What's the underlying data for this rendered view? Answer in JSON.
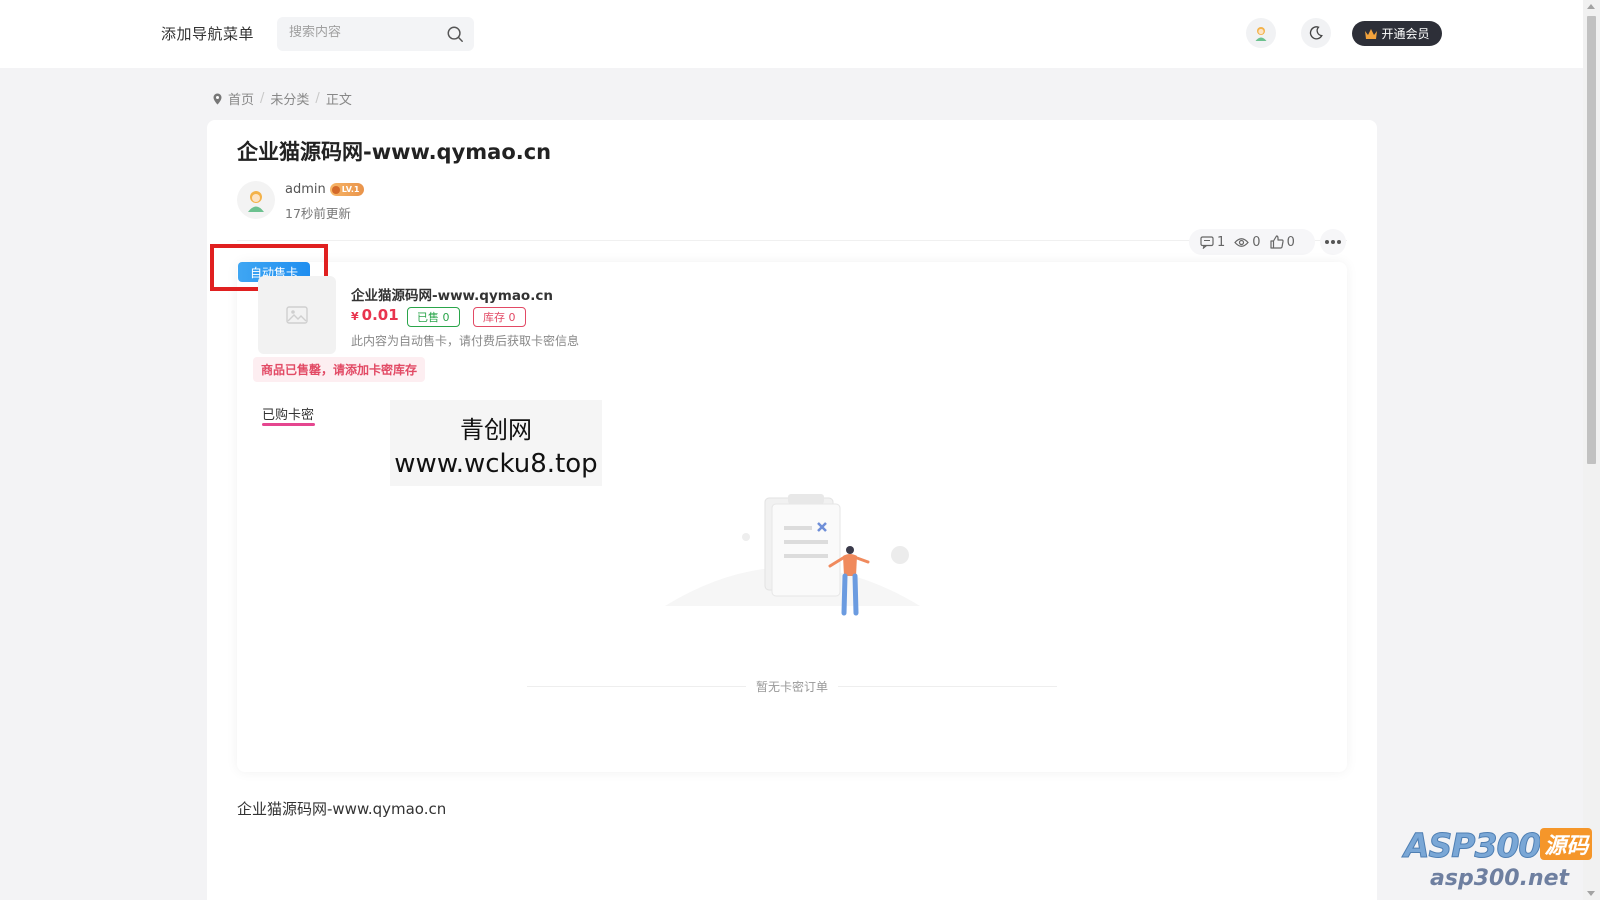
{
  "header": {
    "nav_menu": "添加导航菜单",
    "search_placeholder": "搜索内容",
    "vip_label": "开通会员"
  },
  "breadcrumb": {
    "home": "首页",
    "category": "未分类",
    "current": "正文"
  },
  "post": {
    "title": "企业猫源码网-www.qymao.cn",
    "author": "admin",
    "level": "LV.1",
    "updated": "17秒前更新",
    "stats": {
      "comments": "1",
      "views": "0",
      "likes": "0"
    },
    "body": "企业猫源码网-www.qymao.cn"
  },
  "product": {
    "tag": "自动售卡",
    "title": "企业猫源码网-www.qymao.cn",
    "currency": "¥",
    "price": "0.01",
    "sold": "已售 0",
    "stock": "库存 0",
    "description": "此内容为自动售卡，请付费后获取卡密信息",
    "soldout_note": "商品已售罄，请添加卡密库存",
    "tab_label": "已购卡密",
    "empty_text": "暂无卡密订单"
  },
  "overlay": {
    "watermark_line1": "青创网",
    "watermark_line2": "www.wcku8.top",
    "brand_main": "ASP300",
    "brand_tag": "源码",
    "brand_url": "asp300.net"
  },
  "colors": {
    "accent_pink": "#e5468f",
    "price_red": "#e8344e",
    "sold_green": "#2aa54a",
    "tag_blue": "#1f8ef0",
    "highlight_red": "#e02020"
  }
}
